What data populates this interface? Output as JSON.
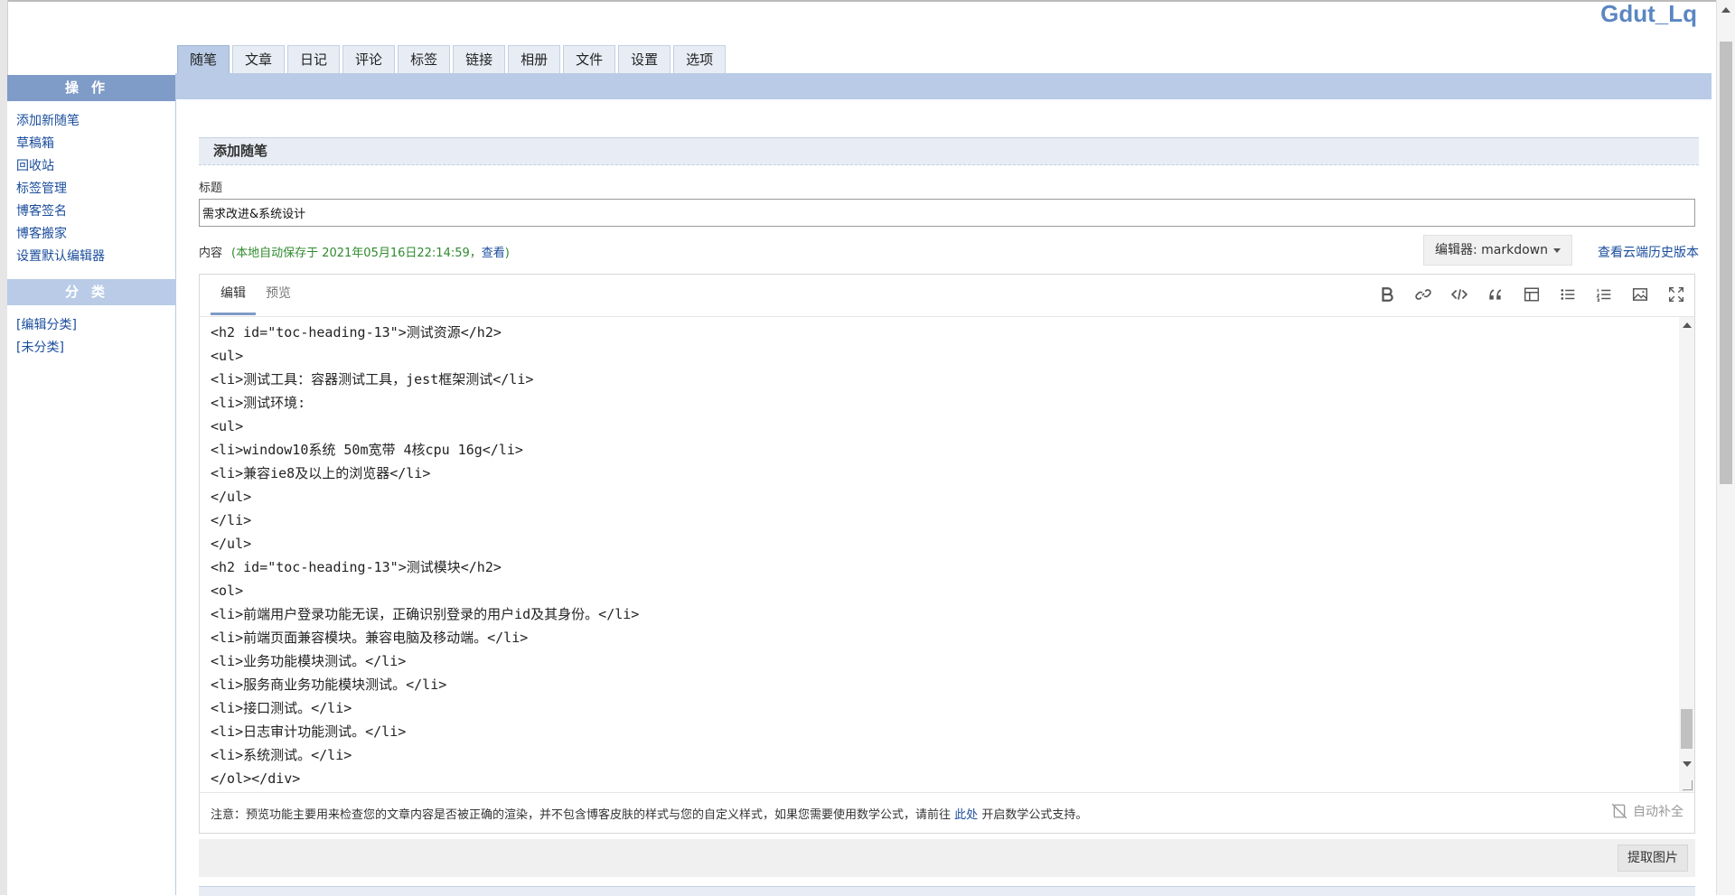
{
  "site": {
    "title": "Gdut_Lq"
  },
  "top_tabs": [
    {
      "label": "随笔",
      "active": true
    },
    {
      "label": "文章",
      "active": false
    },
    {
      "label": "日记",
      "active": false
    },
    {
      "label": "评论",
      "active": false
    },
    {
      "label": "标签",
      "active": false
    },
    {
      "label": "链接",
      "active": false
    },
    {
      "label": "相册",
      "active": false
    },
    {
      "label": "文件",
      "active": false
    },
    {
      "label": "设置",
      "active": false
    },
    {
      "label": "选项",
      "active": false
    }
  ],
  "sidebar": {
    "operations_heading": "操作",
    "operations": [
      {
        "label": "添加新随笔"
      },
      {
        "label": "草稿箱"
      },
      {
        "label": "回收站"
      },
      {
        "label": "标签管理"
      },
      {
        "label": "博客签名"
      },
      {
        "label": "博客搬家"
      },
      {
        "label": "设置默认编辑器"
      }
    ],
    "category_heading": "分类",
    "categories": [
      {
        "label": "[编辑分类]"
      },
      {
        "label": "[未分类]"
      }
    ]
  },
  "form": {
    "panel_title": "添加随笔",
    "title_label": "标题",
    "title_value": "需求改进&系统设计",
    "content_label": "内容",
    "autosave_prefix": "(本地自动保存于 2021年05月16日22:14:59，",
    "autosave_link": "查看",
    "autosave_suffix": ")",
    "editor_select": "编辑器: markdown",
    "history_link": "查看云端历史版本"
  },
  "editor": {
    "tabs": [
      {
        "label": "编辑",
        "active": true
      },
      {
        "label": "预览",
        "active": false
      }
    ],
    "tools": [
      {
        "icon": "bold-icon"
      },
      {
        "icon": "link-icon"
      },
      {
        "icon": "code-icon"
      },
      {
        "icon": "quote-icon"
      },
      {
        "icon": "table-icon"
      },
      {
        "icon": "bullet-list-icon"
      },
      {
        "icon": "ordered-list-icon"
      },
      {
        "icon": "image-icon"
      },
      {
        "icon": "fullscreen-icon"
      }
    ],
    "lines": [
      "<h2 id=\"toc-heading-13\">测试资源</h2>",
      "<ul>",
      "<li>测试工具：容器测试工具，jest框架测试</li>",
      "<li>测试环境:",
      "<ul>",
      "<li>window10系统 50m宽带 4核cpu 16g</li>",
      "<li>兼容ie8及以上的浏览器</li>",
      "</ul>",
      "</li>",
      "</ul>",
      "<h2 id=\"toc-heading-13\">测试模块</h2>",
      "<ol>",
      "<li>前端用户登录功能无误，正确识别登录的用户id及其身份。</li>",
      "<li>前端页面兼容模块。兼容电脑及移动端。</li>",
      "<li>业务功能模块测试。</li>",
      "<li>服务商业务功能模块测试。</li>",
      "<li>接口测试。</li>",
      "<li>日志审计功能测试。</li>",
      "<li>系统测试。</li>",
      "</ol></div>"
    ],
    "footer_note_prefix": "注意：预览功能主要用来检查您的文章内容是否被正确的渲染，并不包含博客皮肤的样式与您的自定义样式，如果您需要使用数学公式，请前往",
    "footer_note_link": "此处",
    "footer_note_suffix": "开启数学公式支持。",
    "autocomplete_label": "自动补全",
    "extract_button": "提取图片"
  }
}
